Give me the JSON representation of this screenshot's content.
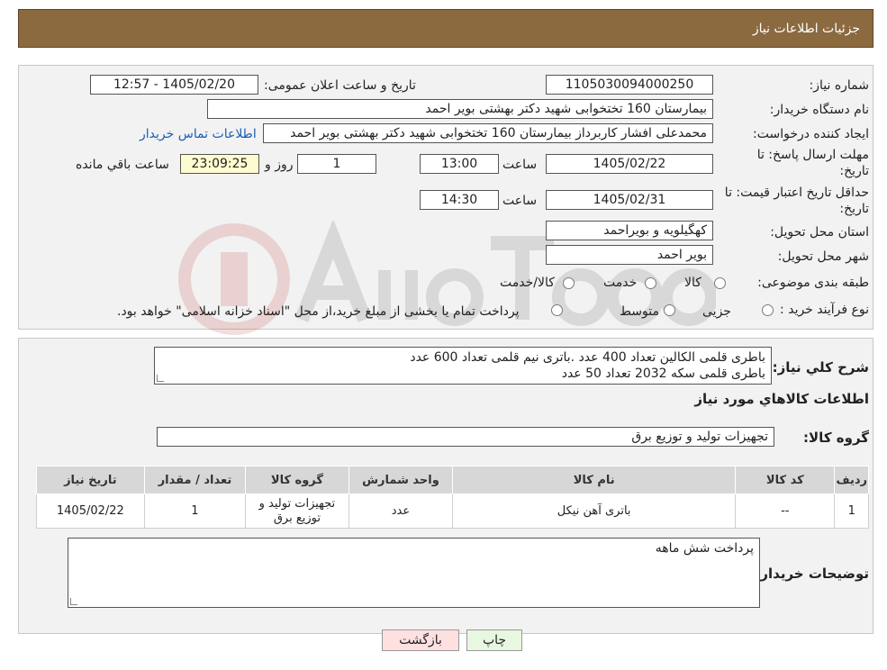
{
  "header": {
    "title": "جزئیات اطلاعات نیاز"
  },
  "form": {
    "need_number_label": "شماره نیاز:",
    "need_number": "1105030094000250",
    "announce_label": "تاریخ و ساعت اعلان عمومی:",
    "announce_value": "1405/02/20 - 12:57",
    "buyer_org_label": "نام دستگاه خریدار:",
    "buyer_org": "بیمارستان 160 تختخوابی شهید دکتر بهشتی بویر احمد",
    "requester_label": "ایجاد کننده درخواست:",
    "requester": "محمدعلی افشار کاربرداز بیمارستان 160 تختخوابی شهید دکتر بهشتی بویر احمد",
    "contact_link": "اطلاعات تماس خریدار",
    "reply_deadline_label_1": "مهلت ارسال پاسخ: تا",
    "reply_deadline_label_2": "تاریخ:",
    "reply_date": "1405/02/22",
    "hour_label": "ساعت",
    "reply_time": "13:00",
    "remaining_days": "1",
    "days_and_label": "روز و",
    "remaining_time": "23:09:25",
    "remaining_label": "ساعت باقي مانده",
    "price_validity_label_1": "حداقل تاریخ اعتبار قیمت: تا",
    "price_validity_label_2": "تاریخ:",
    "validity_date": "1405/02/31",
    "validity_time": "14:30",
    "province_label": "استان محل تحویل:",
    "province": "کهگیلویه و بویراحمد",
    "city_label": "شهر محل تحویل:",
    "city": "بویر احمد",
    "category_label": "طبقه بندی موضوعی:",
    "category_options": [
      "کالا",
      "خدمت",
      "کالا/خدمت"
    ],
    "process_label": "نوع فرآیند خرید :",
    "process_options": [
      "جزیی",
      "متوسط"
    ],
    "process_note": "پرداخت تمام یا بخشی از مبلغ خرید،از محل \"اسناد خزانه اسلامی\" خواهد بود."
  },
  "summary": {
    "label": "شرح کلي نياز:",
    "lines": [
      "باطری قلمی الکالین تعداد 400 عدد .باتری نیم قلمی تعداد 600 عدد",
      "باطری قلمی سکه 2032 تعداد 50 عدد"
    ],
    "items_heading": "اطلاعات کالاهاي مورد نياز",
    "group_label": "گروه کالا:",
    "group_value": "تجهیزات تولید و توزیع برق"
  },
  "table": {
    "headers": [
      "ردیف",
      "کد کالا",
      "نام کالا",
      "واحد شمارش",
      "گروه کالا",
      "تعداد / مقدار",
      "تاریخ نیاز"
    ],
    "rows": [
      [
        "1",
        "--",
        "باتری آهن نیکل",
        "عدد",
        "تجهیزات تولید و توزیع برق",
        "1",
        "1405/02/22"
      ]
    ]
  },
  "buyer_notes": {
    "label": "توضیحات خریدار:",
    "text": "پرداخت شش ماهه"
  },
  "buttons": {
    "print": "چاپ",
    "back": "بازگشت"
  },
  "colors": {
    "header_bg": "#8b6a40",
    "panel_bg": "#f2f2f2",
    "back_button_bg": "#ffe0e0",
    "print_button_bg": "#e8f7e0"
  }
}
